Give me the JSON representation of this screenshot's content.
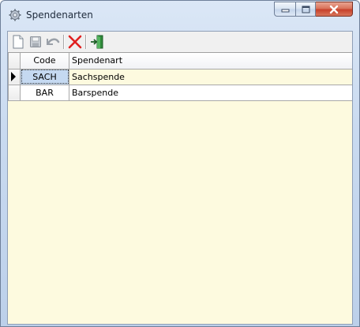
{
  "window": {
    "title": "Spendenarten",
    "icon": "gear-icon"
  },
  "toolbar": {
    "buttons": [
      {
        "name": "new",
        "icon": "new-document-icon"
      },
      {
        "name": "save",
        "icon": "save-icon"
      },
      {
        "name": "undo",
        "icon": "undo-icon"
      },
      {
        "name": "delete",
        "icon": "delete-icon"
      },
      {
        "name": "exit",
        "icon": "exit-door-icon"
      }
    ]
  },
  "grid": {
    "columns": [
      "Code",
      "Spendenart"
    ],
    "rows": [
      {
        "code": "SACH",
        "art": "Sachspende"
      },
      {
        "code": "BAR",
        "art": "Barspende"
      }
    ],
    "selected_row": 0
  },
  "colors": {
    "grid_background": "#fdfadf",
    "selected_cell": "#c5d9f1",
    "close_button": "#c8412b",
    "delete_icon": "#e02020"
  }
}
